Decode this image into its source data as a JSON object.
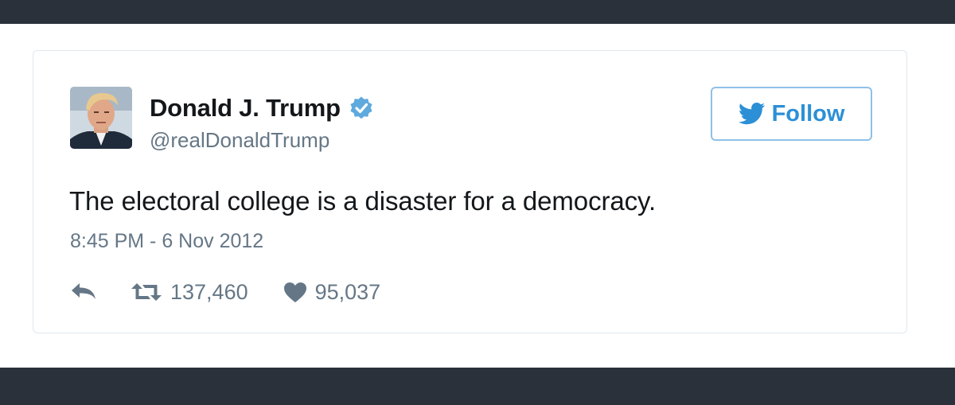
{
  "tweet": {
    "display_name": "Donald J. Trump",
    "handle": "@realDonaldTrump",
    "verified": true,
    "follow_label": "Follow",
    "text": "The electoral college is a disaster for a democracy.",
    "timestamp": "8:45 PM - 6 Nov 2012",
    "retweet_count": "137,460",
    "like_count": "95,037"
  },
  "icons": {
    "verified": "verified-badge-icon",
    "follow": "twitter-bird-icon",
    "reply": "reply-icon",
    "retweet": "retweet-icon",
    "like": "heart-icon"
  },
  "colors": {
    "frame_bar": "#2b313b",
    "card_border": "#e1e8ed",
    "brand_blue": "#1da1f2",
    "follow_border": "#8ec1e8",
    "text_primary": "#14171a",
    "text_secondary": "#657786"
  }
}
